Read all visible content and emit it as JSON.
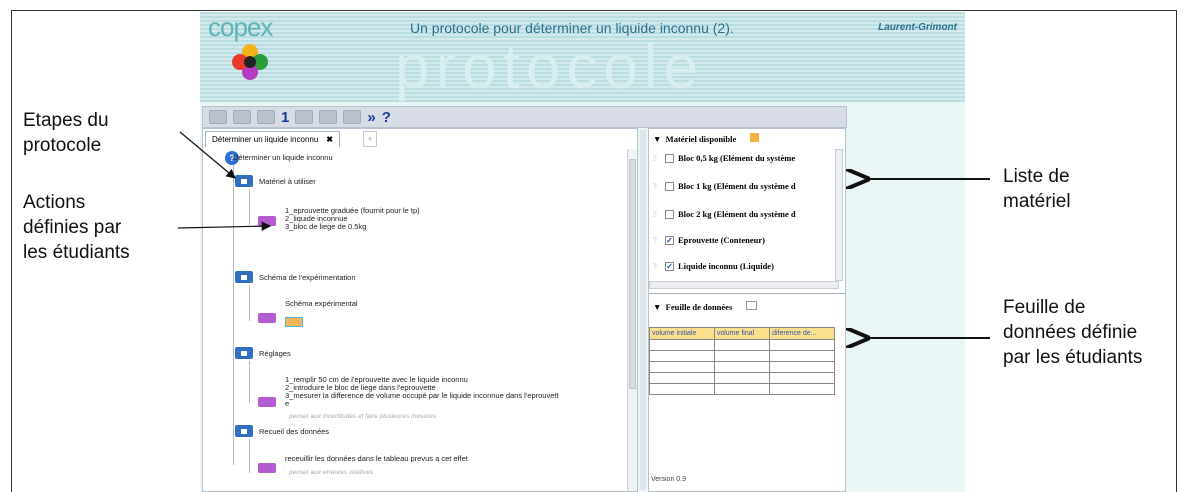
{
  "app": {
    "brand": "copex",
    "title": "Un protocole pour déterminer un liquide inconnu (2).",
    "author": "Laurent-Grimont",
    "banner_word": "protocole"
  },
  "toolbar": {
    "page_num": "1",
    "forward": "»",
    "help": "?"
  },
  "tabs": [
    {
      "label": "Déterminer un liquide inconnu",
      "close": "✖"
    }
  ],
  "tree": {
    "root": "Déterminer un liquide inconnu",
    "materiel": {
      "title": "Matériel à utiliser",
      "lines": [
        "1_eprouvette graduée (fournit pour le tp)",
        "2_liquide inconnue",
        "3_bloc de liege de 0.5kg"
      ]
    },
    "schema": {
      "title": "Schéma de l'expérimentation",
      "sub": "Schéma expérimental"
    },
    "reglages": {
      "title": "Réglages",
      "lines": [
        "1_remplir 50 cm de l'eprouvette avec le liquide inconnu",
        "2_introduire le bloc de liege dans l'eprouvette",
        "3_mesurer la difference de volume occupé par le liquide inconnue dans l'eprouvett",
        "e"
      ],
      "hint": "penser aux incertitudes et faire plusieures mesures"
    },
    "recueil": {
      "title": "Recueil des données",
      "line": "receuillir les données dans le tableau prevus a cet effet",
      "hint": "penser aux erreures relatives"
    }
  },
  "materiel_panel": {
    "header": "Matériel disponible",
    "items": [
      {
        "label": "Bloc 0,5 kg (Elément du système",
        "checked": false
      },
      {
        "label": "Bloc 1 kg (Elément du système d",
        "checked": false
      },
      {
        "label": "Bloc 2 kg (Elément du système d",
        "checked": false
      },
      {
        "label": "Eprouvette (Conteneur)",
        "checked": true
      },
      {
        "label": "Liquide inconnu (Liquide)",
        "checked": true
      }
    ]
  },
  "data_sheet": {
    "header": "Feuille de données",
    "columns": [
      "volume initiale",
      "volume final",
      "diference de..."
    ]
  },
  "version": "Version 0.9",
  "callouts": {
    "etapes": [
      "Etapes du",
      "protocole"
    ],
    "actions": [
      "Actions",
      "définies par",
      "les étudiants"
    ],
    "liste": [
      "Liste de",
      "matériel"
    ],
    "feuille": [
      "Feuille  de",
      "données définie",
      "par les étudiants"
    ]
  }
}
